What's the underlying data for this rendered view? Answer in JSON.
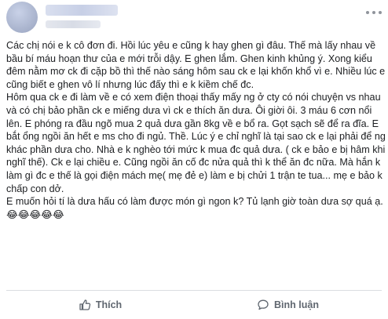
{
  "post": {
    "paragraphs": [
      "Các chị nói e k cô đơn đi. Hồi lúc yêu e cũng k hay ghen gì đâu. Thế mà lấy nhau về bầu bí máu hoạn thư của e mới trỗi dậy. E ghen lắm. Ghen kinh khủng ý. Xong kiểu đêm nằm mơ ck đi cặp bồ thì thế nào sáng hôm sau ck e lại khốn khổ vì e. Nhiều lúc e cũng biết e ghen vô lí nhưng lúc đấy thì e k kiềm chế đc.",
      "Hôm qua ck e đi làm về e có xem điện thoại thấy mấy ng ở cty có nói chuyện vs nhau và có chị bảo phần ck e miếng dưa vì ck e thích ăn dưa. Ôi giời ôi. 3 máu 6 cơn nổi lên. E phóng ra đầu ngõ mua 2 quả dưa gần 8kg về e bổ ra. Gọt sạch sẽ để ra đĩa. E bắt ổng ngồi ăn hết e ms cho đi ngủ. Thề. Lúc ý e chỉ nghĩ là tại sao ck e lại phải để ng khác phần dưa cho. Nhà e k nghèo tới mức k mua đc quả dưa. ( ck e bảo e bị hâm khi nghĩ thế). Ck e lại chiều e. Cũng ngồi ăn cố đc nửa quả thì k thể ăn đc nữa. Mà hắn k làm gì đc e thế là gọi điện mách mẹ( mẹ đẻ e) làm e bị chửi 1 trận te tua... mẹ e bảo k chấp con dở.",
      "E muốn hỏi tí là dưa hấu có làm được món gì ngon k? Tủ lạnh giờ toàn dưa sợ quá ạ. 😂😂😂😂😂"
    ]
  },
  "actions": {
    "like_label": "Thích",
    "comment_label": "Bình luận"
  },
  "icons": {
    "more": "more-options-icon",
    "like": "thumbs-up-icon",
    "comment": "comment-icon"
  },
  "colors": {
    "text": "#1c1e21",
    "action_text": "#606770",
    "divider": "#dadde1"
  }
}
